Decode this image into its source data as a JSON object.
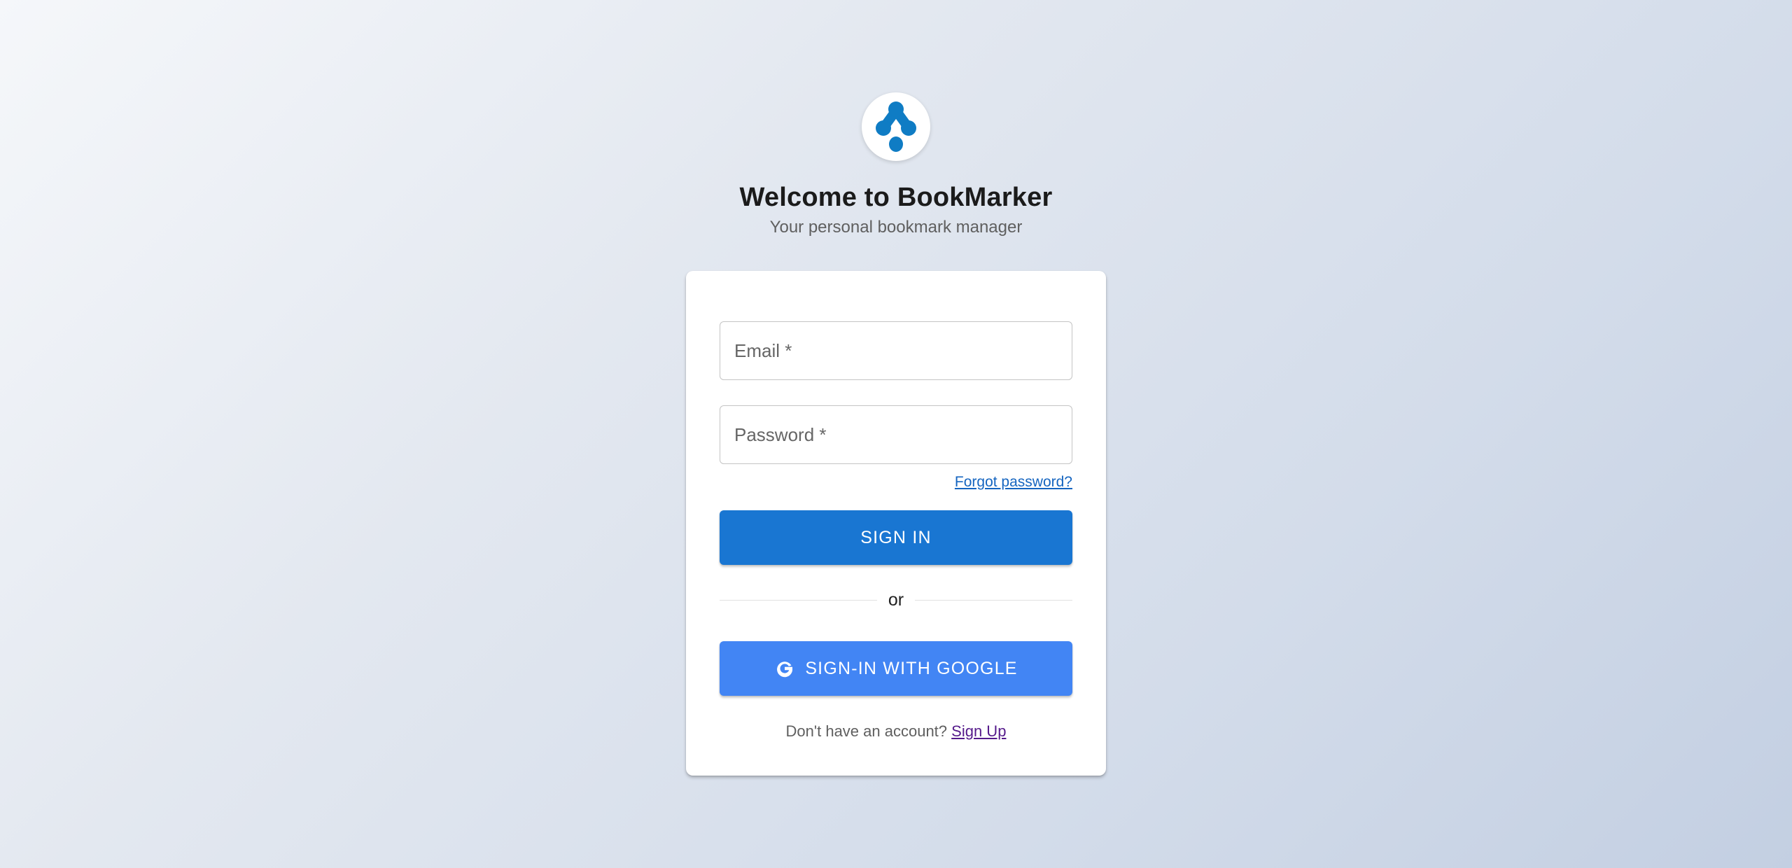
{
  "brand": {
    "logo_icon": "bookmarker-logo-icon",
    "logo_color": "#0f7cc4",
    "title": "Welcome to BookMarker",
    "subtitle": "Your personal bookmark manager"
  },
  "form": {
    "email": {
      "label": "Email *",
      "value": ""
    },
    "password": {
      "label": "Password *",
      "value": ""
    },
    "forgot_password": "Forgot password?",
    "sign_in_label": "SIGN IN",
    "divider_text": "or",
    "google_label": "SIGN-IN WITH GOOGLE",
    "google_icon": "google-g-icon",
    "signup_prompt": "Don't have an account?",
    "signup_link": "Sign Up"
  },
  "colors": {
    "primary": "#1976d2",
    "google": "#4285f4",
    "link": "#1565c0",
    "visited_link": "#551a8b"
  }
}
